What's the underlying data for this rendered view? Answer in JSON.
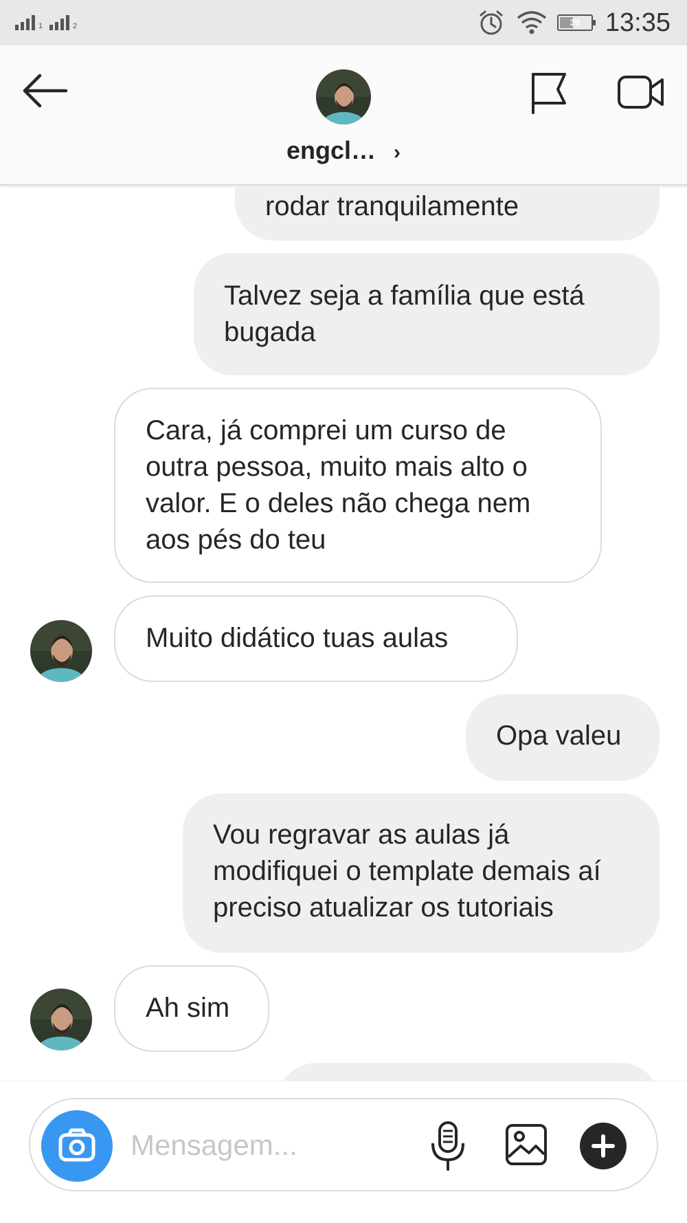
{
  "status_bar": {
    "sim1_label": "1",
    "sim2_label": "2",
    "battery_level": "39",
    "time": "13:35",
    "icons": [
      "signal-icon",
      "alarm-icon",
      "wifi-icon",
      "battery-icon"
    ]
  },
  "header": {
    "username": "engcl…",
    "icons": [
      "back-arrow-icon",
      "avatar",
      "chevron-right-icon",
      "flag-icon",
      "video-call-icon"
    ]
  },
  "messages": [
    {
      "direction": "out",
      "text": "rodar tranquilamente"
    },
    {
      "direction": "out",
      "text": "Talvez seja a família que está bugada"
    },
    {
      "direction": "in",
      "text": "Cara, já comprei um curso de outra pessoa, muito mais alto o valor. E o deles não chega nem aos pés do teu"
    },
    {
      "direction": "in",
      "text": "Muito didático tuas aulas"
    },
    {
      "direction": "out",
      "text": "Opa valeu"
    },
    {
      "direction": "out",
      "text": "Vou regravar as aulas já modifiquei o template demais aí preciso atualizar os tutoriais"
    },
    {
      "direction": "in",
      "text": "Ah sim"
    }
  ],
  "composer": {
    "placeholder": "Mensagem...",
    "icons": [
      "camera-icon",
      "microphone-icon",
      "image-icon",
      "plus-icon"
    ]
  },
  "colors": {
    "accent": "#3897f0",
    "bubble_out": "#efefef",
    "bubble_in_border": "#dbdbdb",
    "text": "#262626"
  }
}
